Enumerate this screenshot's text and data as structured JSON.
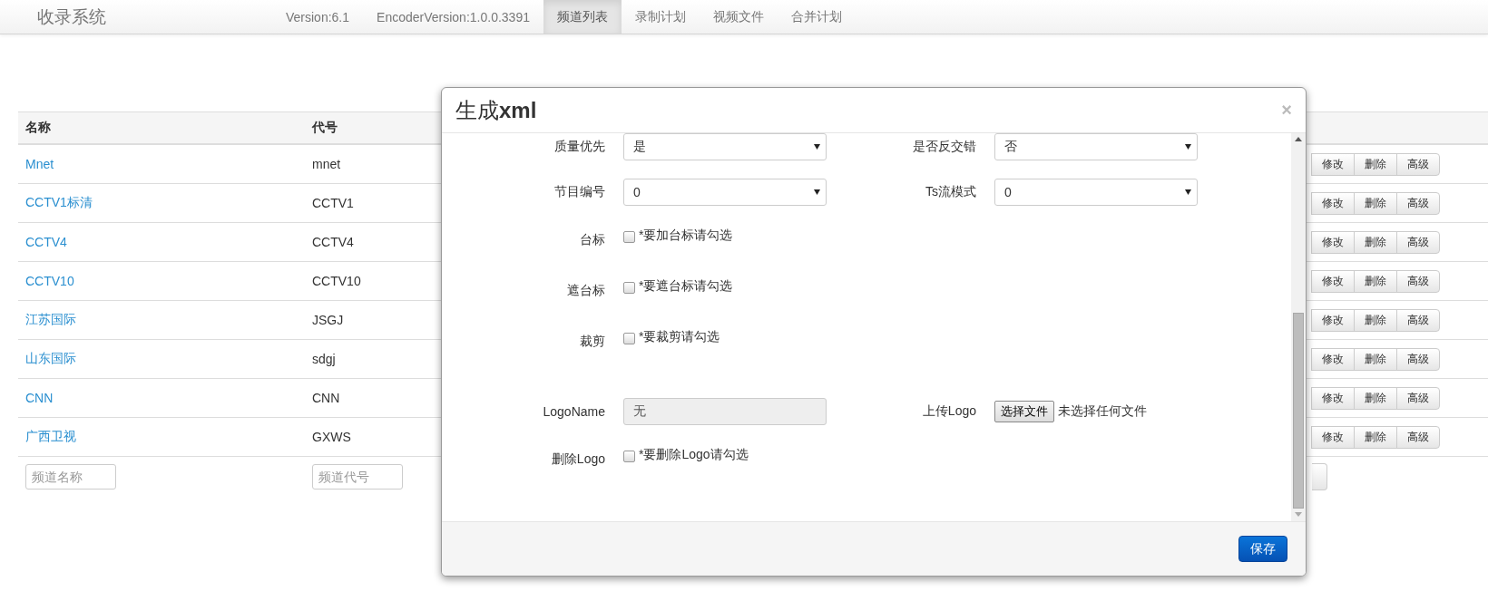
{
  "nav": {
    "brand": "收录系统",
    "items": [
      {
        "label": "Version:6.1",
        "selected": false
      },
      {
        "label": "EncoderVersion:1.0.0.3391",
        "selected": false
      },
      {
        "label": "频道列表",
        "selected": true
      },
      {
        "label": "录制计划",
        "selected": false
      },
      {
        "label": "视频文件",
        "selected": false
      },
      {
        "label": "合并计划",
        "selected": false
      }
    ]
  },
  "table": {
    "columns": [
      "名称",
      "代号"
    ],
    "rows": [
      {
        "name": "Mnet",
        "code": "mnet",
        "actions": [
          "修改",
          "删除",
          "高级"
        ]
      },
      {
        "name": "CCTV1标清",
        "code": "CCTV1",
        "actions": [
          "修改",
          "删除",
          "高级"
        ]
      },
      {
        "name": "CCTV4",
        "code": "CCTV4",
        "actions": [
          "修改",
          "删除",
          "高级"
        ]
      },
      {
        "name": "CCTV10",
        "code": "CCTV10",
        "actions": [
          "修改",
          "删除",
          "高级"
        ]
      },
      {
        "name": "江苏国际",
        "code": "JSGJ",
        "actions": [
          "修改",
          "删除",
          "高级"
        ]
      },
      {
        "name": "山东国际",
        "code": "sdgj",
        "actions": [
          "修改",
          "删除",
          "高级"
        ]
      },
      {
        "name": "CNN",
        "code": "CNN",
        "actions": [
          "修改",
          "删除",
          "高级"
        ]
      },
      {
        "name": "广西卫视",
        "code": "GXWS",
        "actions": [
          "修改",
          "删除",
          "高级"
        ]
      }
    ],
    "filters": [
      {
        "placeholder": "频道名称"
      },
      {
        "placeholder": "频道代号"
      }
    ]
  },
  "modal": {
    "title": "生成**xml**",
    "close": "×",
    "rows": [
      [
        {
          "kind": "select",
          "label": "质量优先",
          "value": "是"
        },
        {
          "kind": "select",
          "label": "是否反交错",
          "value": "否"
        }
      ],
      [
        {
          "kind": "select",
          "label": "节目编号",
          "value": "0"
        },
        {
          "kind": "select",
          "label": "Ts流模式",
          "value": "0"
        }
      ],
      [
        {
          "kind": "checkbox",
          "label": "台标",
          "checked": false,
          "hint": "*要加台标请勾选"
        }
      ],
      [
        {
          "kind": "checkbox",
          "label": "遮台标",
          "checked": false,
          "hint": "*要遮台标请勾选"
        }
      ],
      [
        {
          "kind": "checkbox",
          "label": "裁剪",
          "checked": false,
          "hint": "*要裁剪请勾选"
        }
      ],
      [
        {
          "kind": "text",
          "label": "LogoName",
          "value": "无",
          "disabled": true
        },
        {
          "kind": "file",
          "label": "上传Logo",
          "button": "选择文件",
          "status": "未选择任何文件"
        }
      ],
      [
        {
          "kind": "checkbox",
          "label": "删除Logo",
          "checked": false,
          "hint": "*要删除Logo请勾选"
        }
      ]
    ],
    "save": "保存"
  }
}
